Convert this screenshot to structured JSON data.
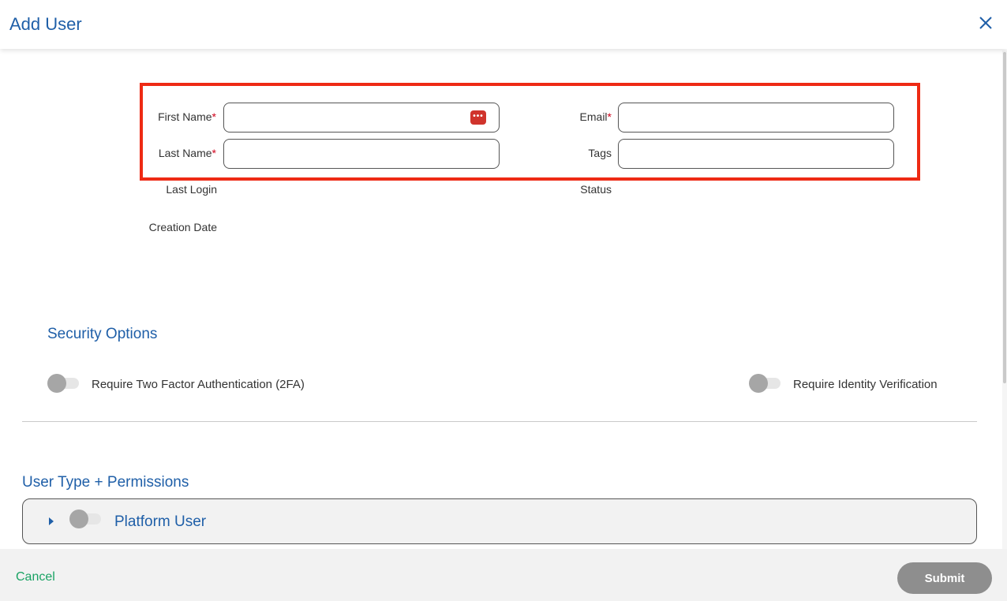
{
  "header": {
    "title": "Add User",
    "close_icon": "close-icon"
  },
  "form": {
    "first_name": {
      "label": "First Name",
      "required_mark": "*",
      "value": "",
      "placeholder": ""
    },
    "last_name": {
      "label": "Last Name",
      "required_mark": "*",
      "value": "",
      "placeholder": ""
    },
    "email": {
      "label": "Email",
      "required_mark": "*",
      "value": "",
      "placeholder": ""
    },
    "tags": {
      "label": "Tags",
      "value": "",
      "placeholder": ""
    },
    "password_manager_icon": "password-manager-icon",
    "last_login": {
      "label": "Last Login"
    },
    "status": {
      "label": "Status"
    },
    "creation_date": {
      "label": "Creation Date"
    }
  },
  "security": {
    "title": "Security Options",
    "toggles": [
      {
        "label": "Require Two Factor Authentication (2FA)",
        "on": false
      },
      {
        "label": "Require Identity Verification",
        "on": false
      }
    ]
  },
  "permissions": {
    "title": "User Type + Permissions",
    "panels": [
      {
        "label": "Platform User",
        "expanded": false,
        "on": false
      }
    ]
  },
  "footer": {
    "cancel_label": "Cancel",
    "submit_label": "Submit"
  },
  "colors": {
    "accent": "#1f5fa8",
    "highlight": "#ee2a14",
    "required": "#d0021b",
    "cancel": "#1aa364",
    "submit_bg": "#8e8e8e"
  }
}
